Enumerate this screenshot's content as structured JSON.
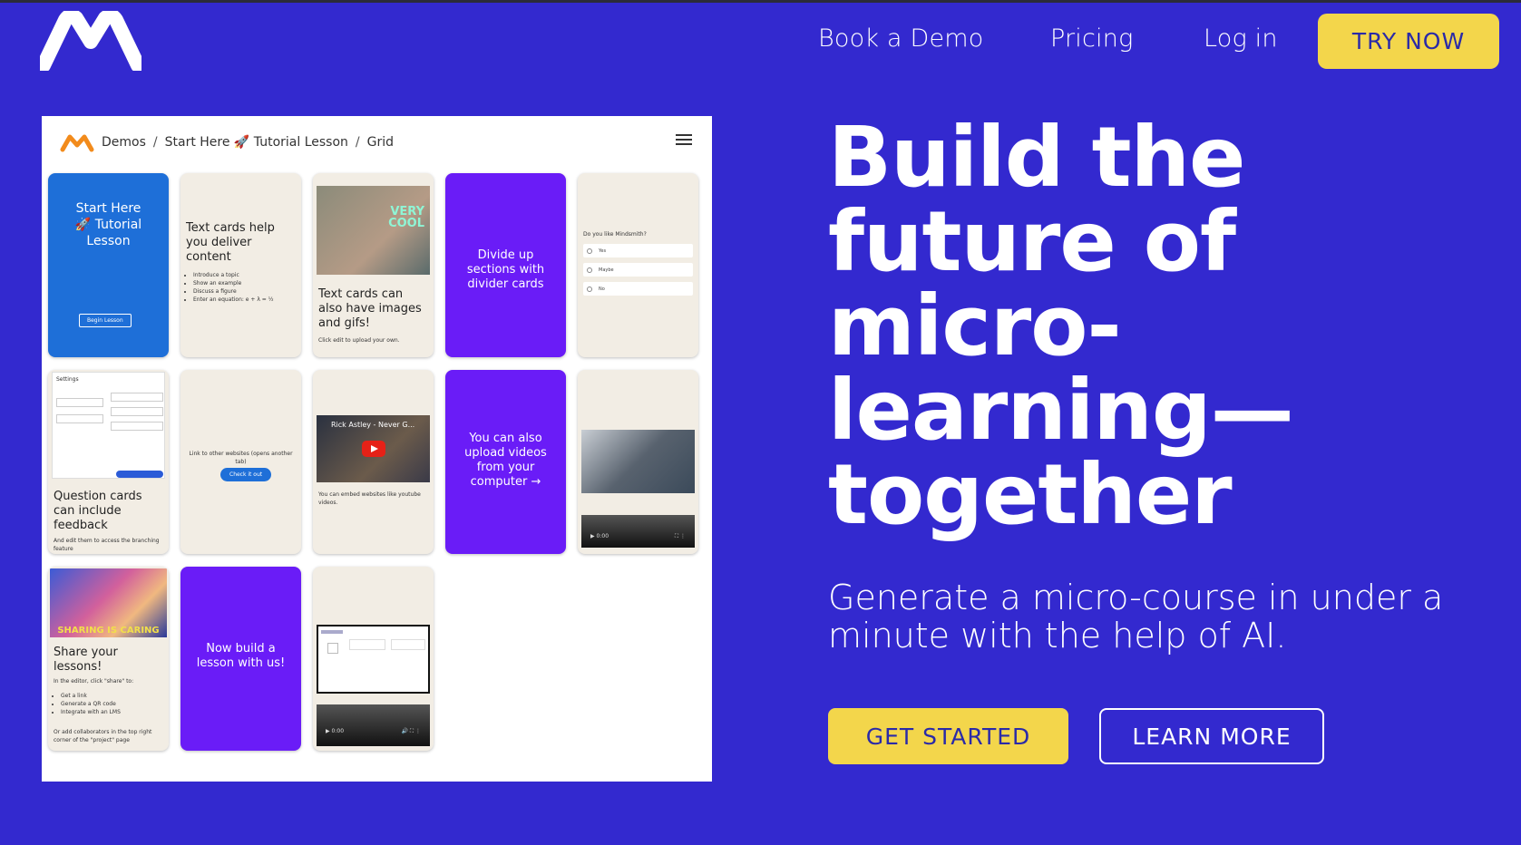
{
  "nav": {
    "logo": "M",
    "links": [
      "Book a Demo",
      "Pricing",
      "Log in"
    ],
    "cta": "TRY NOW"
  },
  "preview": {
    "breadcrumb": [
      "Demos",
      "/",
      "Start Here 🚀 Tutorial Lesson",
      "/",
      "Grid"
    ],
    "menu_icon": "hamburger-icon",
    "cards": {
      "start": {
        "title": "Start Here 🚀 Tutorial Lesson",
        "button": "Begin Lesson"
      },
      "text": {
        "title": "Text cards help you deliver content",
        "bullets": [
          "Introduce a topic",
          "Show an example",
          "Discuss a figure",
          "Enter an equation: e + λ = ½"
        ]
      },
      "images": {
        "gif_caption": "VERY COOL",
        "title": "Text cards can also have images and gifs!",
        "note": "Click edit to upload your own."
      },
      "divider": {
        "title": "Divide up sections with divider cards"
      },
      "question": {
        "prompt": "Do you like Mindsmith?",
        "options": [
          "Yes",
          "Maybe",
          "No"
        ]
      },
      "feedback": {
        "settings_label": "Settings",
        "title": "Question cards can include feedback",
        "note": "And edit them to access the branching feature"
      },
      "link": {
        "title": "Link to other websites (opens another tab)",
        "button": "Check it out"
      },
      "embed": {
        "video_title": "Rick Astley - Never G...",
        "note": "You can embed websites like youtube videos."
      },
      "upload": {
        "title": "You can also upload videos from your computer →"
      },
      "vr_video": {
        "time": "0:00"
      },
      "share": {
        "banner": "SHARING IS CARING",
        "title": "Share your lessons!",
        "intro": "In the editor, click \"share\" to:",
        "bullets": [
          "Get a link",
          "Generate a QR code",
          "Integrate with an LMS"
        ],
        "outro": "Or add collaborators in the top right corner of the \"project\" page"
      },
      "build": {
        "title": "Now build a lesson with us!"
      },
      "screen_video": {
        "time": "0:00"
      }
    }
  },
  "hero": {
    "title": "Build the future of micro-learning—together",
    "title_lines": [
      "Build the",
      "future of",
      "micro-",
      "learning—",
      "together"
    ],
    "subtitle": "Generate a micro-course in under a minute with the help of AI.",
    "primary_cta": "GET STARTED",
    "secondary_cta": "LEARN MORE"
  },
  "colors": {
    "background": "#3329cf",
    "accent_yellow": "#f3d64b",
    "card_blue": "#1e6fd8",
    "card_purple": "#6a1cf7",
    "card_beige": "#f2ede4"
  }
}
